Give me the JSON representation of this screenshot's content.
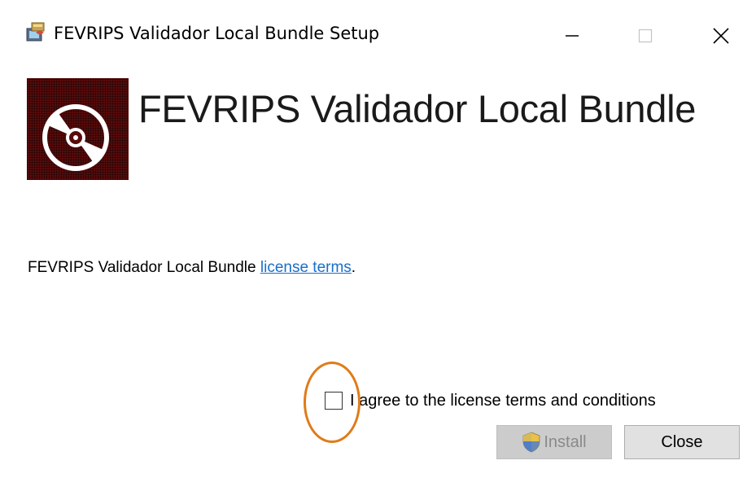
{
  "window": {
    "title": "FEVRIPS Validador Local Bundle Setup",
    "controls": {
      "minimize": "minimize-icon",
      "maximize": "maximize-icon",
      "close": "close-icon"
    }
  },
  "header": {
    "product_title": "FEVRIPS Validador Local Bundle",
    "logo_icon": "disc-icon"
  },
  "license": {
    "prefix": "FEVRIPS Validador Local Bundle ",
    "link_text": "license terms",
    "suffix": "."
  },
  "agreement": {
    "label": "I agree to the license terms and conditions",
    "checked": false
  },
  "buttons": {
    "install_label": "Install",
    "install_enabled": false,
    "close_label": "Close"
  },
  "colors": {
    "link": "#1a6ec9",
    "highlight_ring": "#e07b19",
    "logo_background": "#5a0b0b"
  }
}
